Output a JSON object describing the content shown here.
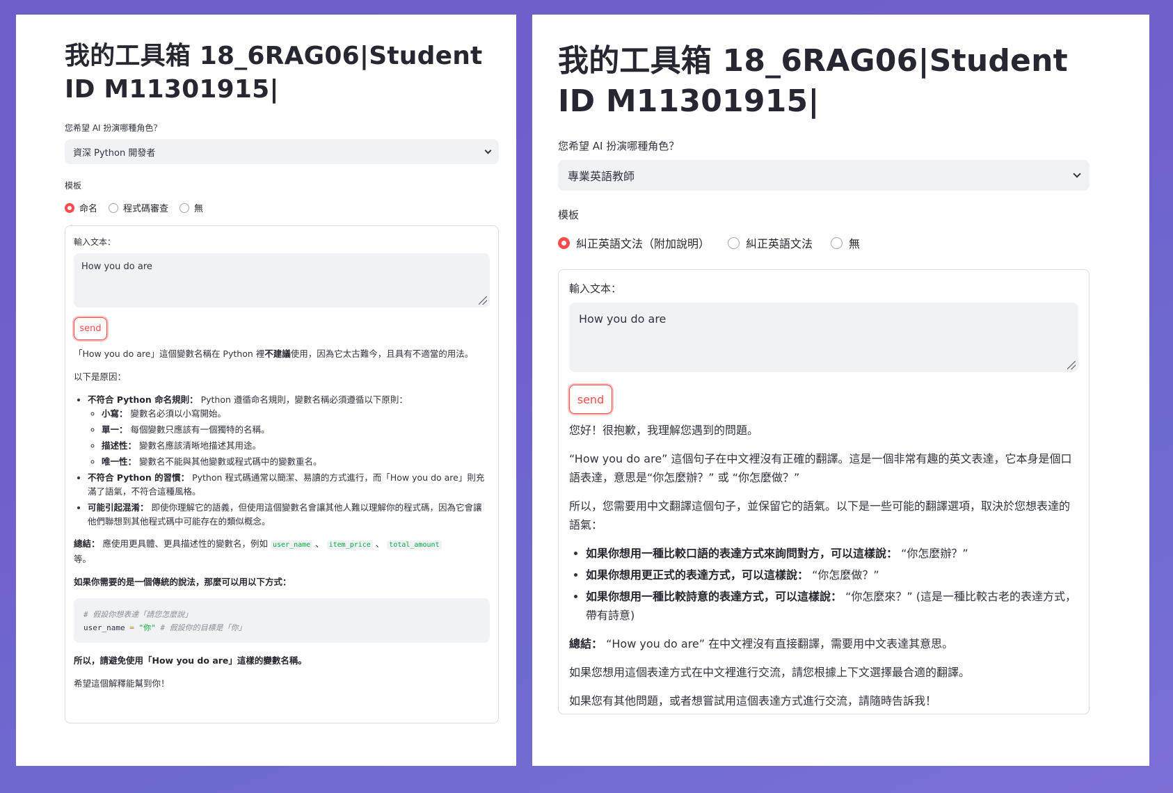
{
  "left": {
    "title": "我的工具箱 18_6RAG06|Student ID M11301915|",
    "role_label": "您希望 AI 扮演哪種角色？",
    "role_value": "資深 Python 開發者",
    "template_label": "模板",
    "template_options": [
      "命名",
      "程式碼審查",
      "無"
    ],
    "input_label": "輸入文本：",
    "input_value": "How you do are",
    "send_label": "send",
    "response": {
      "p1_a": "「How you do are」這個變數名稱在 Python 裡",
      "p1_b": "不建議",
      "p1_c": "使用，因為它太古難今，且具有不適當的用法。",
      "p2": "以下是原因：",
      "b1_title": "不符合 Python 命名規則：",
      "b1_text": " Python 遵循命名規則，變數名稱必須遵循以下原則：",
      "sub1_title": "小寫：",
      "sub1_text": " 變數名必須以小寫開始。",
      "sub2_title": "單一：",
      "sub2_text": " 每個變數只應該有一個獨特的名稱。",
      "sub3_title": "描述性：",
      "sub3_text": " 變數名應該清晰地描述其用途。",
      "sub4_title": "唯一性：",
      "sub4_text": " 變數名不能與其他變數或程式碼中的變數重名。",
      "b2_title": "不符合 Python 的習慣：",
      "b2_text": " Python 程式碼通常以簡潔、易讀的方式進行，而「How you do are」則充滿了語氣，不符合這種風格。",
      "b3_title": "可能引起混淆：",
      "b3_text": " 即使你理解它的語義，但使用這個變數名會讓其他人難以理解你的程式碼，因為它會讓他們聯想到其他程式碼中可能存在的類似概念。",
      "sum_title": "總結：",
      "sum_text": " 應使用更具體、更具描述性的變數名，例如 ",
      "code1": "user_name",
      "sep1": " 、 ",
      "code2": "item_price",
      "sep2": " 、 ",
      "code3": "total_amount",
      "sum_end": "等。",
      "p_traditional": "如果你需要的是一個傳統的說法，那麼可以用以下方式：",
      "code_comment": "# 假設你想表達「請您怎麼說」",
      "code_var": "user_name",
      "code_eq": " = ",
      "code_str": "\"你\"",
      "code_comment2": "  # 假設你的目標是「你」",
      "p_avoid": "所以，請避免使用「How you do are」這樣的變數名稱。",
      "p_hope": "希望這個解釋能幫到你！"
    }
  },
  "right": {
    "title": "我的工具箱 18_6RAG06|Student ID M11301915|",
    "role_label": "您希望 AI 扮演哪種角色？",
    "role_value": "專業英語教師",
    "template_label": "模板",
    "template_options": [
      "糾正英語文法（附加說明）",
      "糾正英語文法",
      "無"
    ],
    "input_label": "輸入文本：",
    "input_value": "How you do are",
    "send_label": "send",
    "response": {
      "p1": "您好！很抱歉，我理解您遇到的問題。",
      "p2": "“How you do are” 這個句子在中文裡沒有正確的翻譯。這是一個非常有趣的英文表達，它本身是個口語表達，意思是“你怎麼辦？” 或 “你怎麼做？”",
      "p3": "所以，您需要用中文翻譯這個句子，並保留它的語氣。以下是一些可能的翻譯選項，取決於您想表達的語氣：",
      "b1_title": "如果你想用一種比較口語的表達方式來詢問對方，可以這樣說：",
      "b1_text": " “你怎麼辦？”",
      "b2_title": "如果你想用更正式的表達方式，可以這樣說：",
      "b2_text": " “你怎麼做？”",
      "b3_title": "如果你想用一種比較詩意的表達方式，可以這樣說：",
      "b3_text": " “你怎麼來？” (這是一種比較古老的表達方式，帶有詩意)",
      "sum_title": "總結：",
      "sum_text": " “How you do are” 在中文裡沒有直接翻譯，需要用中文表達其意思。",
      "p4": "如果您想用這個表達方式在中文裡進行交流，請您根據上下文選擇最合適的翻譯。",
      "p5": "如果您有其他問題，或者想嘗試用這個表達方式進行交流，請隨時告訴我！"
    }
  }
}
